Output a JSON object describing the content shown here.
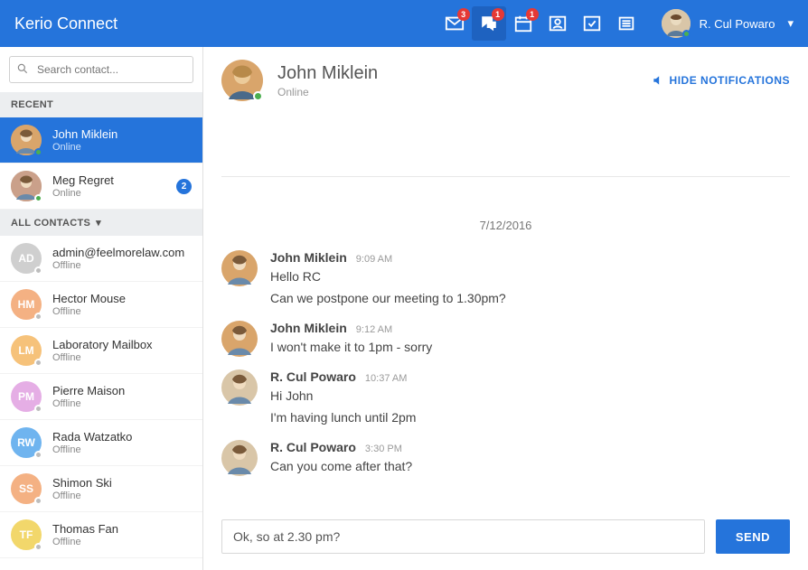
{
  "brand": "Kerio Connect",
  "header": {
    "mail_badge": "3",
    "chat_badge": "1",
    "cal_badge": "1",
    "user_name": "R. Cul Powaro",
    "user_status_color": "#4caf50"
  },
  "search": {
    "placeholder": "Search contact..."
  },
  "sections": {
    "recent": "RECENT",
    "all": "ALL CONTACTS"
  },
  "recent": [
    {
      "name": "John Miklein",
      "status": "Online",
      "selected": true,
      "badge": "",
      "status_color": "#4caf50",
      "avatar_bg": "#d9a56b"
    },
    {
      "name": "Meg Regret",
      "status": "Online",
      "selected": false,
      "badge": "2",
      "status_color": "#4caf50",
      "avatar_bg": "#caa08a"
    }
  ],
  "contacts": [
    {
      "initials": "AD",
      "name": "admin@feelmorelaw.com",
      "status": "Offline",
      "bg": "#cfcfcf"
    },
    {
      "initials": "HM",
      "name": "Hector Mouse",
      "status": "Offline",
      "bg": "#f4b183"
    },
    {
      "initials": "LM",
      "name": "Laboratory Mailbox",
      "status": "Offline",
      "bg": "#f6c27a"
    },
    {
      "initials": "PM",
      "name": "Pierre Maison",
      "status": "Offline",
      "bg": "#e5aee5"
    },
    {
      "initials": "RW",
      "name": "Rada Watzatko",
      "status": "Offline",
      "bg": "#6fb4ef"
    },
    {
      "initials": "SS",
      "name": "Shimon Ski",
      "status": "Offline",
      "bg": "#f4b183"
    },
    {
      "initials": "TF",
      "name": "Thomas Fan",
      "status": "Offline",
      "bg": "#f2d76b"
    }
  ],
  "chat": {
    "title": "John Miklein",
    "subtitle": "Online",
    "status_color": "#4caf50",
    "hide_notifications": "HIDE NOTIFICATIONS",
    "date": "7/12/2016",
    "messages": [
      {
        "author": "John Miklein",
        "time": "9:09 AM",
        "avatar_bg": "#d9a56b",
        "lines": [
          "Hello RC",
          "Can we postpone our meeting to 1.30pm?"
        ]
      },
      {
        "author": "John Miklein",
        "time": "9:12 AM",
        "avatar_bg": "#d9a56b",
        "lines": [
          "I won't make it to 1pm - sorry"
        ]
      },
      {
        "author": "R. Cul Powaro",
        "time": "10:37 AM",
        "avatar_bg": "#d9c6a8",
        "lines": [
          "Hi John",
          "I'm having lunch until 2pm"
        ]
      },
      {
        "author": "R. Cul Powaro",
        "time": "3:30 PM",
        "avatar_bg": "#d9c6a8",
        "lines": [
          "Can you come after that?"
        ]
      }
    ],
    "compose_value": "Ok, so at 2.30 pm?",
    "send_label": "SEND"
  }
}
